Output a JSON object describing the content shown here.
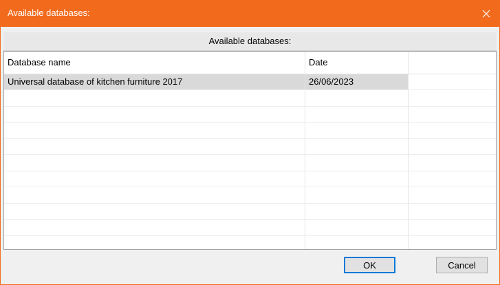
{
  "window": {
    "title": "Available databases:",
    "accent_color": "#f26b1d",
    "close_icon": "close-icon"
  },
  "panel": {
    "header": "Available databases:"
  },
  "table": {
    "columns": [
      "Database name",
      "Date",
      ""
    ],
    "rows": [
      {
        "name": "Universal database of kitchen furniture 2017",
        "date": "26/06/2023",
        "selected": true
      }
    ]
  },
  "buttons": {
    "ok": "OK",
    "cancel": "Cancel"
  }
}
